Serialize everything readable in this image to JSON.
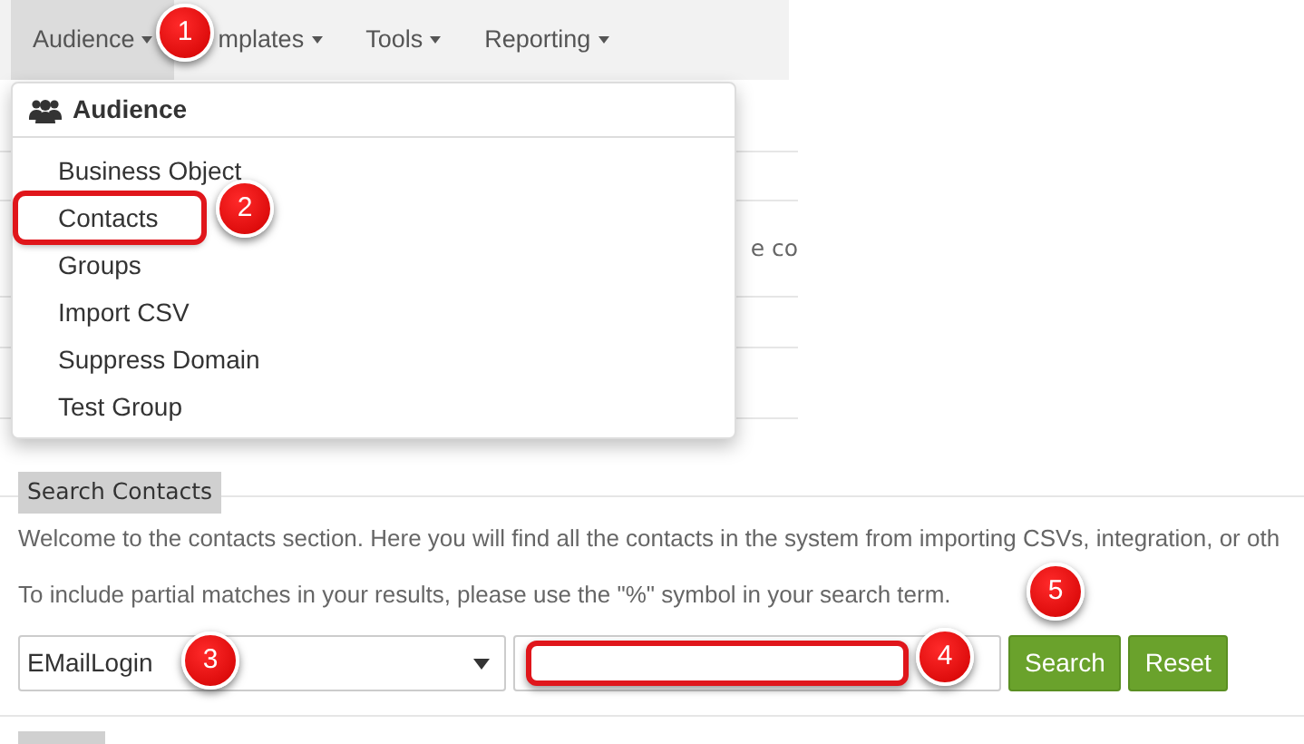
{
  "navbar": {
    "items": [
      {
        "label": "Audience",
        "selected": true
      },
      {
        "label": "mplates",
        "selected": false
      },
      {
        "label": "Tools",
        "selected": false
      },
      {
        "label": "Reporting",
        "selected": false
      }
    ]
  },
  "background_fragments": [
    "e co"
  ],
  "dropdown": {
    "header": "Audience",
    "items": [
      {
        "label": "Business Object",
        "highlighted": false
      },
      {
        "label": "Contacts",
        "highlighted": true
      },
      {
        "label": "Groups",
        "highlighted": false
      },
      {
        "label": "Import CSV",
        "highlighted": false
      },
      {
        "label": "Suppress Domain",
        "highlighted": false
      },
      {
        "label": "Test Group",
        "highlighted": false
      }
    ]
  },
  "search_panel": {
    "title": "Search Contacts",
    "paragraphs": [
      "Welcome to the contacts section. Here you will find all the contacts in the system from importing CSVs, integration, or oth",
      "To include partial matches in your results, please use the \"%\" symbol in your search term."
    ],
    "field_select": {
      "value": "EMailLogin"
    },
    "search_input": {
      "highlighted": true
    },
    "buttons": [
      "Search",
      "Reset"
    ]
  },
  "callouts": [
    {
      "label": "1"
    },
    {
      "label": "2"
    },
    {
      "label": "3"
    },
    {
      "label": "4"
    },
    {
      "label": "5"
    }
  ]
}
